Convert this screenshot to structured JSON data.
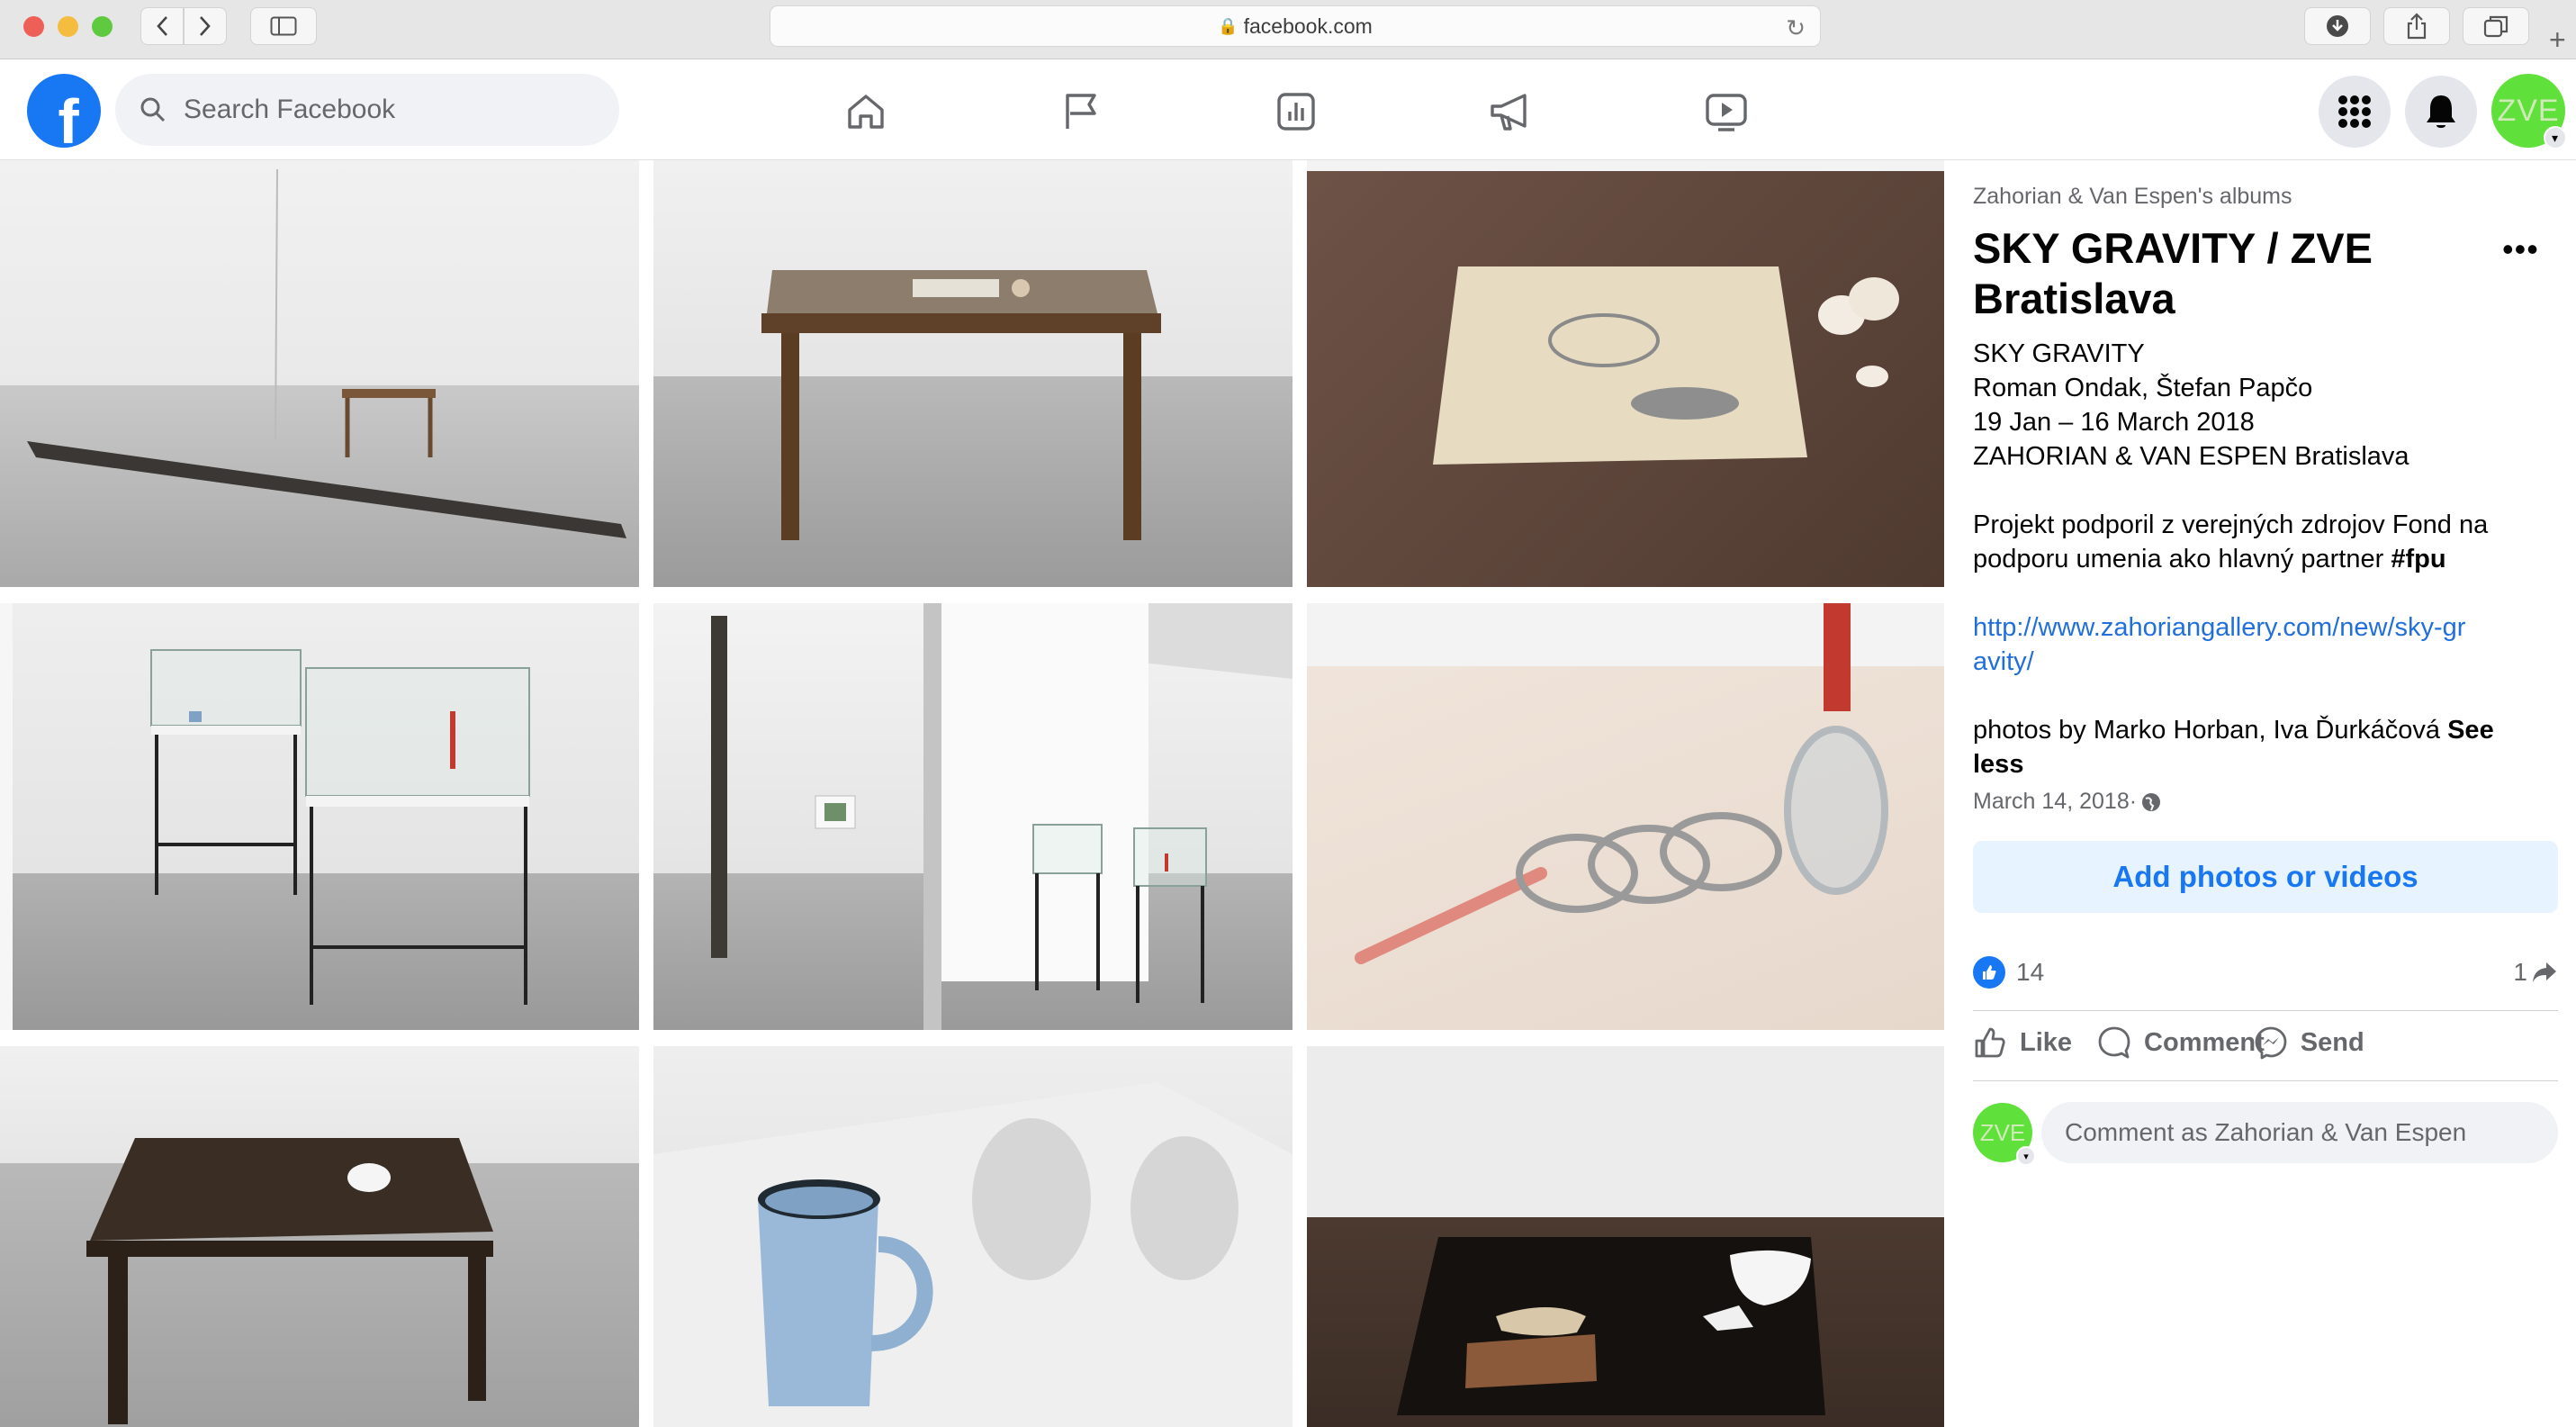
{
  "browser": {
    "url": "facebook.com"
  },
  "nav": {
    "search_placeholder": "Search Facebook",
    "avatar_initials": "ZVE"
  },
  "panel": {
    "album_link": "Zahorian & Van Espen's albums",
    "title": "SKY GRAVITY / ZVE Bratislava",
    "more": "•••",
    "desc_lines": [
      "SKY GRAVITY",
      "Roman Ondak, Štefan Papčo",
      "19 Jan – 16 March 2018",
      "ZAHORIAN & VAN ESPEN Bratislava"
    ],
    "funding_text": "Projekt podporil z verejných zdrojov Fond na podporu umenia ako hlavný partner ",
    "funding_tag": "#fpu",
    "link": "http://www.zahoriangallery.com/new/sky-gravity/",
    "photos_credit": "photos by Marko Horban, Iva Ďurkáčová ",
    "see_less": "See less",
    "date": "March 14, 2018",
    "date_sep": " · ",
    "add_button": "Add photos or videos",
    "likes_count": "14",
    "shares_count": "1",
    "like_label": "Like",
    "comment_label": "Comment",
    "send_label": "Send",
    "comment_placeholder": "Comment as Zahorian & Van Espen",
    "mini_avatar_initials": "ZVE"
  },
  "colors": {
    "brand": "#1877f2",
    "avatar_green": "#5fe03a"
  }
}
